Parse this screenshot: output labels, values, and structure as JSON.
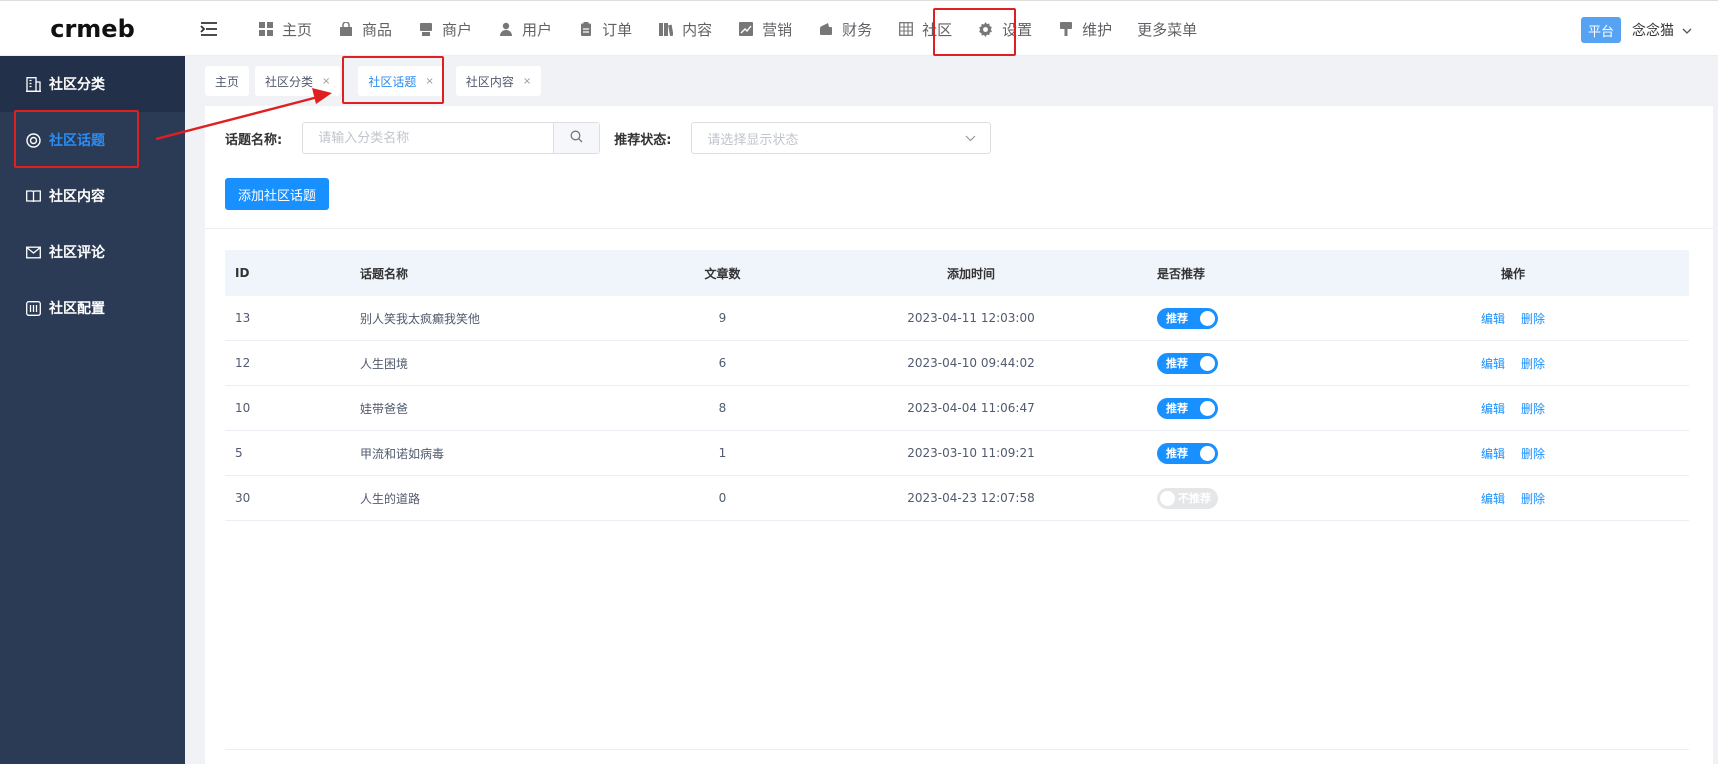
{
  "header": {
    "logo_text": "crmeb",
    "nav": [
      {
        "label": "主页",
        "icon": "grid-icon"
      },
      {
        "label": "商品",
        "icon": "bag-icon"
      },
      {
        "label": "商户",
        "icon": "store-icon"
      },
      {
        "label": "用户",
        "icon": "user-icon"
      },
      {
        "label": "订单",
        "icon": "clipboard-icon"
      },
      {
        "label": "内容",
        "icon": "book-icon"
      },
      {
        "label": "营销",
        "icon": "trend-icon"
      },
      {
        "label": "财务",
        "icon": "wallet-icon"
      },
      {
        "label": "社区",
        "icon": "table-icon"
      },
      {
        "label": "设置",
        "icon": "gear-icon"
      },
      {
        "label": "维护",
        "icon": "brush-icon"
      }
    ],
    "more_label": "更多菜单",
    "platform_badge": "平台",
    "user_name": "念念猫"
  },
  "sidebar": {
    "items": [
      {
        "label": "社区分类",
        "icon": "building-icon"
      },
      {
        "label": "社区话题",
        "icon": "lifebuoy-icon"
      },
      {
        "label": "社区内容",
        "icon": "open-book-icon"
      },
      {
        "label": "社区评论",
        "icon": "mail-icon"
      },
      {
        "label": "社区配置",
        "icon": "config-icon"
      }
    ]
  },
  "tabs": [
    {
      "label": "主页",
      "closable": false
    },
    {
      "label": "社区分类",
      "closable": true
    },
    {
      "label": "社区话题",
      "closable": true
    },
    {
      "label": "社区内容",
      "closable": true
    }
  ],
  "filter": {
    "topic_label": "话题名称:",
    "topic_placeholder": "请输入分类名称",
    "status_label": "推荐状态:",
    "status_placeholder": "请选择显示状态"
  },
  "add_button": "添加社区话题",
  "table": {
    "columns": [
      "ID",
      "话题名称",
      "文章数",
      "添加时间",
      "是否推荐",
      "操作"
    ],
    "rows": [
      {
        "id": "13",
        "name": "别人笑我太疯癫我笑他",
        "count": "9",
        "time": "2023-04-11 12:03:00",
        "recommend": "推荐",
        "on": true
      },
      {
        "id": "12",
        "name": "人生困境",
        "count": "6",
        "time": "2023-04-10 09:44:02",
        "recommend": "推荐",
        "on": true
      },
      {
        "id": "10",
        "name": "娃带爸爸",
        "count": "8",
        "time": "2023-04-04 11:06:47",
        "recommend": "推荐",
        "on": true
      },
      {
        "id": "5",
        "name": "甲流和诺如病毒",
        "count": "1",
        "time": "2023-03-10 11:09:21",
        "recommend": "推荐",
        "on": true
      },
      {
        "id": "30",
        "name": "人生的道路",
        "count": "0",
        "time": "2023-04-23 12:07:58",
        "recommend": "不推荐",
        "on": false
      }
    ],
    "edit_label": "编辑",
    "delete_label": "删除"
  },
  "colors": {
    "primary": "#1890ff",
    "sidebar_bg": "#2c3b55",
    "highlight": "#e02020"
  }
}
